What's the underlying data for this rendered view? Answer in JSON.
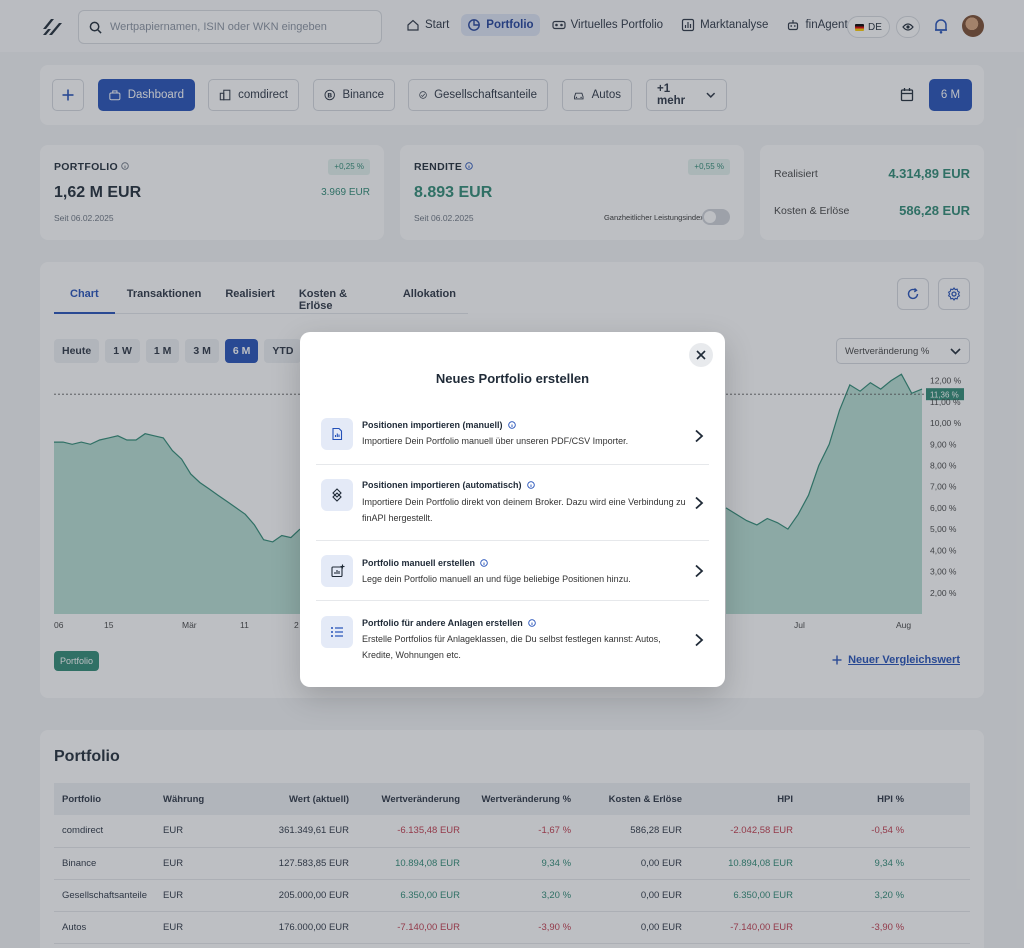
{
  "search": {
    "placeholder": "Wertpapiernamen, ISIN oder WKN eingeben"
  },
  "nav": {
    "items": [
      {
        "label": "Start",
        "icon": "home-icon"
      },
      {
        "label": "Portfolio",
        "icon": "pie-chart-icon",
        "active": true
      },
      {
        "label": "Virtuelles Portfolio",
        "icon": "vr-glasses-icon"
      },
      {
        "label": "Marktanalyse",
        "icon": "bar-chart-icon"
      },
      {
        "label": "finAgent",
        "icon": "robot-icon"
      }
    ],
    "language": "DE"
  },
  "filterbar": {
    "tabs": [
      {
        "label": "Dashboard",
        "icon": "briefcase-icon",
        "active": true
      },
      {
        "label": "comdirect",
        "icon": "building-icon"
      },
      {
        "label": "Binance",
        "icon": "bitcoin-icon"
      },
      {
        "label": "Gesellschaftsanteile",
        "icon": "handshake-icon"
      },
      {
        "label": "Autos",
        "icon": "car-icon"
      }
    ],
    "more_label": "+1 mehr",
    "period_label": "6 M"
  },
  "kpis": {
    "portfolio": {
      "label": "PORTFOLIO",
      "badge": "+0,25 %",
      "value": "1,62 M EUR",
      "sub": "3.969 EUR",
      "since": "Seit 06.02.2025"
    },
    "rendite": {
      "label": "RENDITE",
      "badge": "+0,55 %",
      "value": "8.893 EUR",
      "since": "Seit 06.02.2025",
      "toggle_label": "Ganzheitlicher Leistungsindex"
    },
    "summary": {
      "realisiert_label": "Realisiert",
      "realisiert_value": "4.314,89 EUR",
      "kosten_label": "Kosten & Erlöse",
      "kosten_value": "586,28 EUR"
    }
  },
  "chart_panel": {
    "tabs": [
      "Chart",
      "Transaktionen",
      "Realisiert",
      "Kosten & Erlöse",
      "Allokation"
    ],
    "ranges": [
      "Heute",
      "1 W",
      "1 M",
      "3 M",
      "6 M",
      "YTD"
    ],
    "active_range": "6 M",
    "metric_select": "Wertveränderung %",
    "legend_chip": "Portfolio",
    "compare_link": "Neuer Vergleichswert"
  },
  "chart_data": {
    "type": "area",
    "ylabel": "",
    "y_ticks": [
      "12,00 %",
      "11,00 %",
      "10,00 %",
      "9,00 %",
      "8,00 %",
      "7,00 %",
      "6,00 %",
      "5,00 %",
      "4,00 %",
      "3,00 %",
      "2,00 %"
    ],
    "ylim": [
      1.0,
      12.5
    ],
    "current_value_label": "11,36 %",
    "current_value": 11.36,
    "x_ticks_left": [
      "06",
      "15",
      "Mär",
      "11",
      "2"
    ],
    "x_ticks_right": [
      "Jul",
      "Aug"
    ],
    "series": [
      {
        "name": "Portfolio",
        "visible_left": [
          9.1,
          9.1,
          9.0,
          9.1,
          9.0,
          9.2,
          9.3,
          9.4,
          9.2,
          9.2,
          9.5,
          9.4,
          9.3,
          8.7,
          8.3,
          7.6,
          7.2,
          6.9,
          6.6,
          6.3,
          6.0,
          5.7,
          5.2,
          4.5,
          4.4,
          4.7,
          4.6,
          5.0
        ],
        "visible_right": [
          6.0,
          5.7,
          5.4,
          5.2,
          5.5,
          5.3,
          5.0,
          5.7,
          6.6,
          8.0,
          9.0,
          10.6,
          11.8,
          11.5,
          11.9,
          11.6,
          12.0,
          12.3,
          11.4,
          11.6
        ]
      }
    ]
  },
  "modal": {
    "title": "Neues Portfolio erstellen",
    "options": [
      {
        "title": "Positionen importieren (manuell)",
        "desc": "Importiere Dein Portfolio manuell über unseren PDF/CSV Importer.",
        "icon": "file-chart-icon"
      },
      {
        "title": "Positionen importieren (automatisch)",
        "desc": "Importiere Dein Portfolio direkt von deinem Broker. Dazu wird eine Verbindung zu finAPI hergestellt.",
        "icon": "sync-icon"
      },
      {
        "title": "Portfolio manuell erstellen",
        "desc": "Lege dein Portfolio manuell an und füge beliebige Positionen hinzu.",
        "icon": "add-chart-icon"
      },
      {
        "title": "Portfolio für andere Anlagen erstellen",
        "desc": "Erstelle Portfolios für Anlageklassen, die Du selbst festlegen kannst: Autos, Kredite, Wohnungen etc.",
        "icon": "list-icon"
      }
    ]
  },
  "portfolio_table": {
    "title": "Portfolio",
    "columns": [
      "Portfolio",
      "Währung",
      "Wert (aktuell)",
      "Wertveränderung",
      "Wertveränderung %",
      "Kosten & Erlöse",
      "HPI",
      "HPI %"
    ],
    "rows": [
      [
        "comdirect",
        "EUR",
        "361.349,61 EUR",
        "-6.135,48 EUR",
        "-1,67 %",
        "586,28 EUR",
        "-2.042,58 EUR",
        "-0,54 %"
      ],
      [
        "Binance",
        "EUR",
        "127.583,85 EUR",
        "10.894,08 EUR",
        "9,34 %",
        "0,00 EUR",
        "10.894,08 EUR",
        "9,34 %"
      ],
      [
        "Gesellschaftsanteile",
        "EUR",
        "205.000,00 EUR",
        "6.350,00 EUR",
        "3,20 %",
        "0,00 EUR",
        "6.350,00 EUR",
        "3,20 %"
      ],
      [
        "Autos",
        "EUR",
        "176.000,00 EUR",
        "-7.140,00 EUR",
        "-3,90 %",
        "0,00 EUR",
        "-7.140,00 EUR",
        "-3,90 %"
      ]
    ]
  }
}
